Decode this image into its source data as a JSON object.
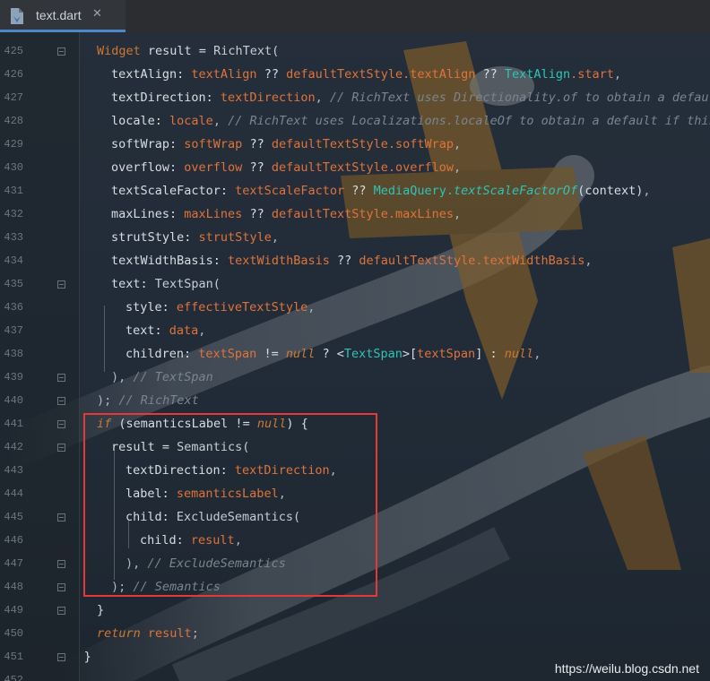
{
  "tab": {
    "file_name": "text.dart",
    "icon": "dart-file-icon"
  },
  "watermark": "https://weilu.blog.csdn.net",
  "colors": {
    "highlight_box": "#e53935",
    "keyword": "#cc7832",
    "field": "#e0733a",
    "comment": "#7a8590",
    "class_ref": "#2ec4b6"
  },
  "lines": [
    {
      "num": "425",
      "indent": 0,
      "fold": true,
      "segments": [
        [
          "kw",
          "Widget "
        ],
        [
          "id",
          "result = "
        ],
        [
          "cls",
          "RichText("
        ]
      ]
    },
    {
      "num": "426",
      "indent": 1,
      "fold": false,
      "segments": [
        [
          "id",
          "textAlign: "
        ],
        [
          "fld",
          "textAlign"
        ],
        [
          "id",
          " ?? "
        ],
        [
          "fld",
          "defaultTextStyle.textAlign"
        ],
        [
          "id",
          " ?? "
        ],
        [
          "cyan",
          "TextAlign"
        ],
        [
          "fld",
          ".start"
        ],
        [
          "punct",
          ","
        ]
      ]
    },
    {
      "num": "427",
      "indent": 1,
      "fold": false,
      "segments": [
        [
          "id",
          "textDirection: "
        ],
        [
          "fld",
          "textDirection"
        ],
        [
          "punct",
          ", "
        ],
        [
          "cmt",
          "// RichText uses Directionality.of to obtain a defaul"
        ]
      ]
    },
    {
      "num": "428",
      "indent": 1,
      "fold": false,
      "segments": [
        [
          "id",
          "locale: "
        ],
        [
          "fld",
          "locale"
        ],
        [
          "punct",
          ", "
        ],
        [
          "cmt",
          "// RichText uses Localizations.localeOf to obtain a default if this"
        ]
      ]
    },
    {
      "num": "429",
      "indent": 1,
      "fold": false,
      "segments": [
        [
          "id",
          "softWrap: "
        ],
        [
          "fld",
          "softWrap"
        ],
        [
          "id",
          " ?? "
        ],
        [
          "fld",
          "defaultTextStyle.softWrap"
        ],
        [
          "punct",
          ","
        ]
      ]
    },
    {
      "num": "430",
      "indent": 1,
      "fold": false,
      "segments": [
        [
          "id",
          "overflow: "
        ],
        [
          "fld",
          "overflow"
        ],
        [
          "id",
          " ?? "
        ],
        [
          "fld",
          "defaultTextStyle.overflow"
        ],
        [
          "punct",
          ","
        ]
      ]
    },
    {
      "num": "431",
      "indent": 1,
      "fold": false,
      "segments": [
        [
          "id",
          "textScaleFactor: "
        ],
        [
          "fld",
          "textScaleFactor"
        ],
        [
          "id",
          " ?? "
        ],
        [
          "cyan",
          "MediaQuery."
        ],
        [
          "cyan ital",
          "textScaleFactorOf"
        ],
        [
          "id",
          "(context)"
        ],
        [
          "punct",
          ","
        ]
      ]
    },
    {
      "num": "432",
      "indent": 1,
      "fold": false,
      "segments": [
        [
          "id",
          "maxLines: "
        ],
        [
          "fld",
          "maxLines"
        ],
        [
          "id",
          " ?? "
        ],
        [
          "fld",
          "defaultTextStyle.maxLines"
        ],
        [
          "punct",
          ","
        ]
      ]
    },
    {
      "num": "433",
      "indent": 1,
      "fold": false,
      "segments": [
        [
          "id",
          "strutStyle: "
        ],
        [
          "fld",
          "strutStyle"
        ],
        [
          "punct",
          ","
        ]
      ]
    },
    {
      "num": "434",
      "indent": 1,
      "fold": false,
      "segments": [
        [
          "id",
          "textWidthBasis: "
        ],
        [
          "fld",
          "textWidthBasis"
        ],
        [
          "id",
          " ?? "
        ],
        [
          "fld",
          "defaultTextStyle.textWidthBasis"
        ],
        [
          "punct",
          ","
        ]
      ]
    },
    {
      "num": "435",
      "indent": 1,
      "fold": true,
      "segments": [
        [
          "id",
          "text: "
        ],
        [
          "cls",
          "TextSpan("
        ]
      ]
    },
    {
      "num": "436",
      "indent": 2,
      "fold": false,
      "segments": [
        [
          "id",
          "style: "
        ],
        [
          "fld",
          "effectiveTextStyle"
        ],
        [
          "punct",
          ","
        ]
      ]
    },
    {
      "num": "437",
      "indent": 2,
      "fold": false,
      "segments": [
        [
          "id",
          "text: "
        ],
        [
          "fld",
          "data"
        ],
        [
          "punct",
          ","
        ]
      ]
    },
    {
      "num": "438",
      "indent": 2,
      "fold": false,
      "segments": [
        [
          "id",
          "children: "
        ],
        [
          "fld",
          "textSpan"
        ],
        [
          "id",
          " != "
        ],
        [
          "kw ital",
          "null"
        ],
        [
          "id",
          " ? <"
        ],
        [
          "cyan",
          "TextSpan"
        ],
        [
          "id",
          ">["
        ],
        [
          "fld",
          "textSpan"
        ],
        [
          "id",
          "] : "
        ],
        [
          "kw ital",
          "null"
        ],
        [
          "punct",
          ","
        ]
      ]
    },
    {
      "num": "439",
      "indent": 1,
      "fold": true,
      "segments": [
        [
          "punct",
          "), "
        ],
        [
          "cmt",
          "// TextSpan"
        ]
      ]
    },
    {
      "num": "440",
      "indent": 0,
      "fold": true,
      "segments": [
        [
          "punct",
          "); "
        ],
        [
          "cmt",
          "// RichText"
        ]
      ]
    },
    {
      "num": "441",
      "indent": 0,
      "fold": true,
      "segments": [
        [
          "kw ital",
          "if"
        ],
        [
          "id",
          " (semanticsLabel != "
        ],
        [
          "kw ital",
          "null"
        ],
        [
          "id",
          ") {"
        ]
      ]
    },
    {
      "num": "442",
      "indent": 1,
      "fold": true,
      "segments": [
        [
          "id",
          "result = "
        ],
        [
          "cls",
          "Semantics("
        ]
      ]
    },
    {
      "num": "443",
      "indent": 2,
      "fold": false,
      "segments": [
        [
          "id",
          "textDirection: "
        ],
        [
          "fld",
          "textDirection"
        ],
        [
          "punct",
          ","
        ]
      ]
    },
    {
      "num": "444",
      "indent": 2,
      "fold": false,
      "segments": [
        [
          "id",
          "label: "
        ],
        [
          "fld",
          "semanticsLabel"
        ],
        [
          "punct",
          ","
        ]
      ]
    },
    {
      "num": "445",
      "indent": 2,
      "fold": true,
      "segments": [
        [
          "id",
          "child: "
        ],
        [
          "cls",
          "ExcludeSemantics("
        ]
      ]
    },
    {
      "num": "446",
      "indent": 3,
      "fold": false,
      "segments": [
        [
          "id",
          "child: "
        ],
        [
          "fld",
          "result"
        ],
        [
          "punct",
          ","
        ]
      ]
    },
    {
      "num": "447",
      "indent": 2,
      "fold": true,
      "segments": [
        [
          "punct",
          "), "
        ],
        [
          "cmt",
          "// ExcludeSemantics"
        ]
      ]
    },
    {
      "num": "448",
      "indent": 1,
      "fold": true,
      "segments": [
        [
          "punct",
          "); "
        ],
        [
          "cmt",
          "// Semantics"
        ]
      ]
    },
    {
      "num": "449",
      "indent": 0,
      "fold": true,
      "segments": [
        [
          "id",
          "}"
        ]
      ]
    },
    {
      "num": "450",
      "indent": 0,
      "fold": false,
      "segments": [
        [
          "kw ital",
          "return "
        ],
        [
          "fld",
          "result"
        ],
        [
          "punct",
          ";"
        ]
      ]
    },
    {
      "num": "451",
      "indent": -1,
      "fold": true,
      "segments": [
        [
          "id",
          "}"
        ]
      ]
    },
    {
      "num": "452",
      "indent": -1,
      "fold": false,
      "segments": []
    }
  ]
}
